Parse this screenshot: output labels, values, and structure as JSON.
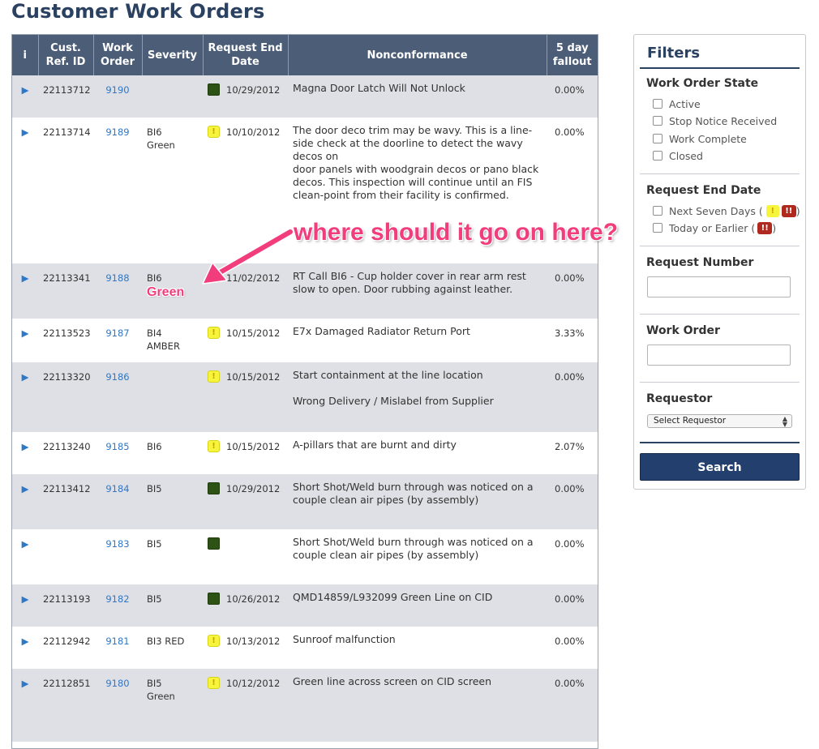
{
  "page": {
    "title": "Customer Work Orders"
  },
  "table": {
    "headers": [
      "i",
      "Cust. Ref. ID",
      "Work Order",
      "Severity",
      "Request End Date",
      "Nonconformance",
      "5 day fallout"
    ],
    "rows": [
      {
        "ref": "22113712",
        "wo": "9190",
        "severity": "",
        "flag": "green",
        "date": "10/29/2012",
        "nc": "Magna Door Latch Will Not Unlock",
        "fallout": "0.00%"
      },
      {
        "ref": "22113714",
        "wo": "9189",
        "severity": "BI6 Green",
        "flag": "yellow",
        "date": "10/10/2012",
        "nc": "The door deco trim may be wavy.  This is a line-side check at the doorline to detect the wavy decos on\ndoor panels with woodgrain decos or pano black decos. This inspection will continue until an FIS clean-point from their facility is confirmed.",
        "fallout": "0.00%"
      },
      {
        "ref": "22113341",
        "wo": "9188",
        "severity": "BI6",
        "flag": "",
        "date": "11/02/2012",
        "nc": "RT Call BI6 - Cup holder cover in rear arm rest slow to open.  Door rubbing against leather.",
        "fallout": "0.00%"
      },
      {
        "ref": "22113523",
        "wo": "9187",
        "severity": "BI4 AMBER",
        "flag": "yellow",
        "date": "10/15/2012",
        "nc": "E7x Damaged Radiator Return Port",
        "fallout": "3.33%"
      },
      {
        "ref": "22113320",
        "wo": "9186",
        "severity": "",
        "flag": "yellow",
        "date": "10/15/2012",
        "nc": "Start containment at the line location\n\nWrong Delivery / Mislabel from Supplier",
        "fallout": "0.00%"
      },
      {
        "ref": "22113240",
        "wo": "9185",
        "severity": "BI6",
        "flag": "yellow",
        "date": "10/15/2012",
        "nc": "A-pillars that are burnt and dirty",
        "fallout": "2.07%"
      },
      {
        "ref": "22113412",
        "wo": "9184",
        "severity": "BI5",
        "flag": "green",
        "date": "10/29/2012",
        "nc": "Short Shot/Weld burn through was noticed on a couple clean air pipes (by assembly)",
        "fallout": "0.00%"
      },
      {
        "ref": "",
        "wo": "9183",
        "severity": "BI5",
        "flag": "green",
        "date": "",
        "nc": "Short Shot/Weld burn through was noticed on a couple clean air pipes (by assembly)",
        "fallout": "0.00%"
      },
      {
        "ref": "22113193",
        "wo": "9182",
        "severity": "BI5",
        "flag": "green",
        "date": "10/26/2012",
        "nc": "QMD14859/L932099 Green Line on CID",
        "fallout": "0.00%"
      },
      {
        "ref": "22112942",
        "wo": "9181",
        "severity": "BI3 RED",
        "flag": "yellow",
        "date": "10/13/2012",
        "nc": "Sunroof malfunction",
        "fallout": "0.00%"
      },
      {
        "ref": "22112851",
        "wo": "9180",
        "severity": "BI5 Green",
        "flag": "yellow",
        "date": "10/12/2012",
        "nc": "Green line across screen on CID screen",
        "fallout": "0.00%"
      }
    ]
  },
  "filters": {
    "title": "Filters",
    "state_title": "Work Order State",
    "states": [
      "Active",
      "Stop Notice Received",
      "Work Complete",
      "Closed"
    ],
    "date_title": "Request End Date",
    "date_next7": "Next Seven Days (",
    "date_today": "Today or Earlier (",
    "close_paren": ")",
    "request_number_title": "Request Number",
    "work_order_title": "Work Order",
    "requestor_title": "Requestor",
    "requestor_selected": "Select Requestor",
    "search_label": "Search"
  },
  "badges": {
    "warning": "!",
    "critical": "!!"
  },
  "annotations": {
    "question": "where should it go on here?",
    "label": "Green"
  },
  "colors": {
    "header": "#4c5d77",
    "title": "#2b4161",
    "link": "#2f78c7",
    "flag_green": "#2c5314",
    "flag_yellow": "#f7f43c",
    "flag_red": "#b0291e",
    "annotation": "#f23d7c",
    "search_button": "#233f6e"
  }
}
